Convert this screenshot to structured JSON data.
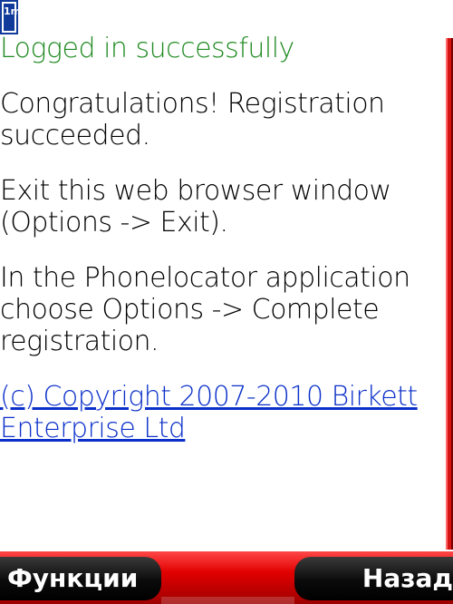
{
  "app": {
    "logo_text": "1m"
  },
  "page": {
    "status": "Logged in successfully",
    "paragraphs": [
      "Congratulations! Registration succeeded.",
      "Exit this web browser window (Options -> Exit).",
      "In the Phonelocator application choose Options -> Complete registration."
    ],
    "copyright": "(c) Copyright 2007-2010 Birkett Enterprise Ltd"
  },
  "softkeys": {
    "left": "Функции",
    "right": "Назад"
  },
  "colors": {
    "status": "#1f8a21",
    "link": "#0b30c9",
    "text": "#000000",
    "softbar": "#e10000",
    "softkey": "#000000",
    "softkey_text": "#ffffff",
    "logo_bg": "#123a9a"
  }
}
